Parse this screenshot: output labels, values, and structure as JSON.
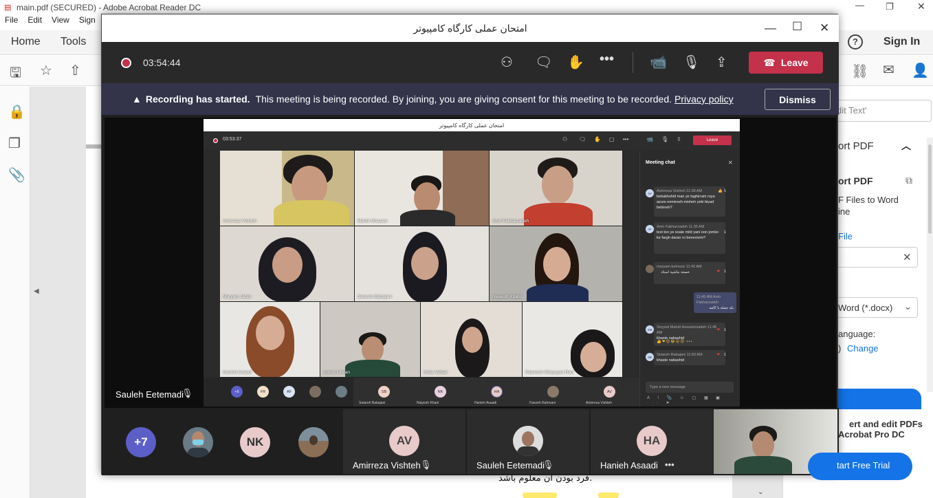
{
  "acrobat": {
    "window_title": "main.pdf (SECURED) - Adobe Acrobat Reader DC",
    "menu": [
      "File",
      "Edit",
      "View",
      "Sign"
    ],
    "tabs": {
      "home": "Home",
      "tools": "Tools"
    },
    "sign_in": "Sign In",
    "help": "?",
    "doc_text": "فرد بودن آن معلوم باشد.",
    "right_panel": {
      "search_placeholder": "dit Text'",
      "export_header": "ort PDF",
      "export_title": "ort PDF",
      "convert_line1": "F Files to Word",
      "convert_line2": "ine",
      "file_link": "File",
      "format": "Word (*.docx)",
      "language_label": "anguage:",
      "language_value": ")",
      "change_link": "Change",
      "promo_line1": "ert and edit PDFs",
      "promo_line2": "Acrobat Pro DC",
      "trial_button": "tart Free Trial"
    }
  },
  "teams": {
    "title": "امتحان عملی کارگاه کامپیوتر",
    "timer": "03:54:44",
    "leave_label": "Leave",
    "notice": {
      "bold": "Recording has started.",
      "text": "This meeting is being recorded. By joining, you are giving consent for this meeting to be recorded.",
      "link": "Privacy policy",
      "dismiss": "Dismiss"
    },
    "presenter": "Sauleh Eetemadi",
    "shared_screen": {
      "title": "امتحان عملی کارگاه کامپیوتر",
      "timer": "03:53:37",
      "leave_label": "Leave",
      "tiles": [
        {
          "name": "Amirreza Vishteh"
        },
        {
          "name": "Mahdi Ghazavi"
        },
        {
          "name": "Amir Fakharzadeh"
        },
        {
          "name": "Maryam Jafari"
        },
        {
          "name": "Setareh Babajani"
        },
        {
          "name": "Niayesh Khani"
        },
        {
          "name": "Hanieh Asaadi"
        },
        {
          "name": "mahdi fathian"
        },
        {
          "name": "Helia Vafaei"
        },
        {
          "name": "Fatemeh Nikipayan Rad"
        }
      ],
      "roster_avatars": [
        "+5",
        "FR",
        "AF"
      ],
      "roster_named": [
        {
          "initials": "SB",
          "name": "Setareh Babajani"
        },
        {
          "initials": "NK",
          "name": "Niayesh Khani"
        },
        {
          "initials": "HA",
          "name": "Hanieh Asaadi"
        },
        {
          "initials": "",
          "name": "Faezeh Rahmani"
        },
        {
          "initials": "AV",
          "name": "Amirreza Vishteh"
        }
      ],
      "chat": {
        "header": "Meeting chat",
        "messages": [
          {
            "initials": "AV",
            "meta": "Amirreza Vishteh   11:38 AM",
            "text": "bebakhshid man ye taghirram roya azure nemirseh misheh yeki biyad bebineh?",
            "reaction": "1"
          },
          {
            "initials": "AF",
            "meta": "Amir Fakharzadeh   11:35 AM",
            "text": "text too ye soale mild yani oon jomlei ke fargh daran ro benevisim?",
            "reaction": "1"
          },
          {
            "initials": "",
            "meta": "maryam behrooz   11:42 AM",
            "text": "خسته نباشید استاد",
            "reaction": "1"
          },
          {
            "initials": "",
            "meta": "11:45 AM  Amir Fakharzadeh",
            "text": "بله جمله با کامه"
          },
          {
            "initials": "SM",
            "meta": "Seyyed Mahdi Hosseinizadeh  11:45 AM",
            "text": "khaste nabashid",
            "reaction": "1"
          },
          {
            "initials": "SB",
            "meta": "Setareh Babajani   11:50 AM",
            "text": "khaste nabashid",
            "reaction": "1"
          }
        ],
        "input_placeholder": "Type a new message"
      }
    },
    "bottom_strip": {
      "overflow": "+7",
      "avatar_nk": "NK",
      "tiles": [
        {
          "initials": "AV",
          "name": "Amirreza Vishteh"
        },
        {
          "initials": "",
          "name": "Sauleh Eetemadi"
        },
        {
          "initials": "HA",
          "name": "Hanieh Asaadi"
        }
      ]
    }
  },
  "colors": {
    "leave": "#c4314b",
    "notice_bg": "#33344a",
    "teams_bg": "#1f1f1f",
    "adobe_blue": "#1473e6"
  }
}
